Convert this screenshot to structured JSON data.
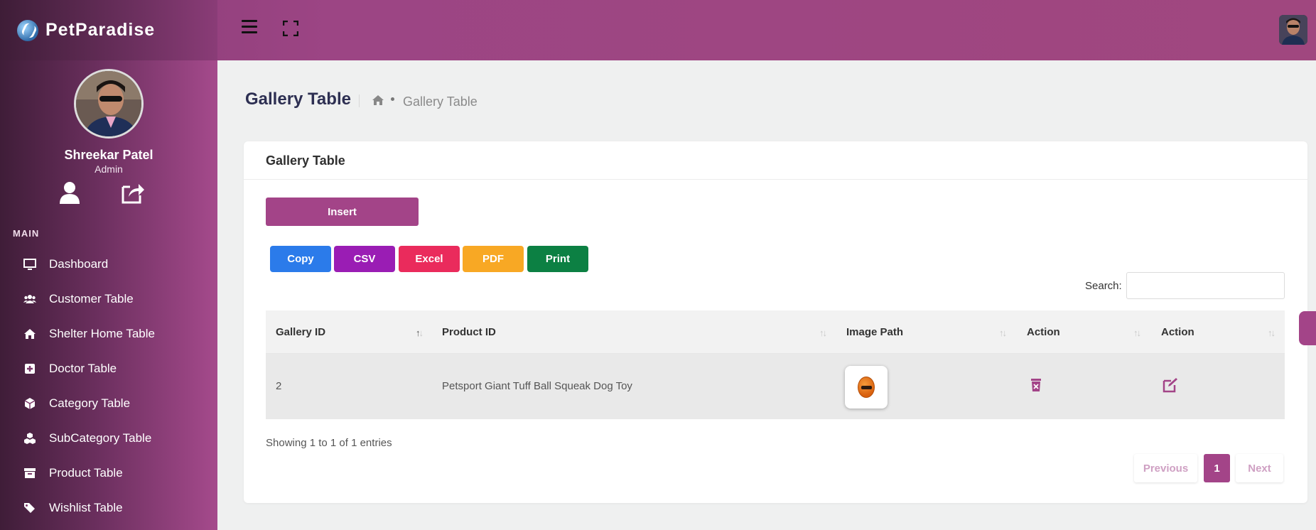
{
  "brand": {
    "name": "PetParadise"
  },
  "header": {
    "menu_icon": "hamburger-icon",
    "fullscreen_icon": "expand-icon"
  },
  "profile": {
    "name": "Shreekar Patel",
    "role": "Admin"
  },
  "sidebar": {
    "section_label": "MAIN",
    "items": [
      {
        "label": "Dashboard",
        "icon": "monitor-icon"
      },
      {
        "label": "Customer Table",
        "icon": "users-icon"
      },
      {
        "label": "Shelter Home Table",
        "icon": "home-icon"
      },
      {
        "label": "Doctor Table",
        "icon": "medical-plus-icon"
      },
      {
        "label": "Category Table",
        "icon": "cube-icon"
      },
      {
        "label": "SubCategory Table",
        "icon": "cubes-icon"
      },
      {
        "label": "Product Table",
        "icon": "archive-icon"
      },
      {
        "label": "Wishlist Table",
        "icon": "tags-icon"
      }
    ]
  },
  "page": {
    "title": "Gallery Table",
    "breadcrumb": "Gallery Table"
  },
  "card": {
    "title": "Gallery Table",
    "insert_label": "Insert",
    "export_buttons": [
      {
        "label": "Copy",
        "color": "#2b7bea"
      },
      {
        "label": "CSV",
        "color": "#9a1db4"
      },
      {
        "label": "Excel",
        "color": "#ea2b5c"
      },
      {
        "label": "PDF",
        "color": "#f8a824"
      },
      {
        "label": "Print",
        "color": "#0c8043"
      }
    ],
    "search_label": "Search:"
  },
  "table": {
    "columns": [
      "Gallery ID",
      "Product ID",
      "Image Path",
      "Action",
      "Action"
    ],
    "rows": [
      {
        "gallery_id": "2",
        "product_id": "Petsport Giant Tuff Ball Squeak Dog Toy"
      }
    ]
  },
  "footer": {
    "info": "Showing 1 to 1 of 1 entries",
    "prev": "Previous",
    "page": "1",
    "next": "Next"
  },
  "colors": {
    "accent": "#a34488"
  }
}
